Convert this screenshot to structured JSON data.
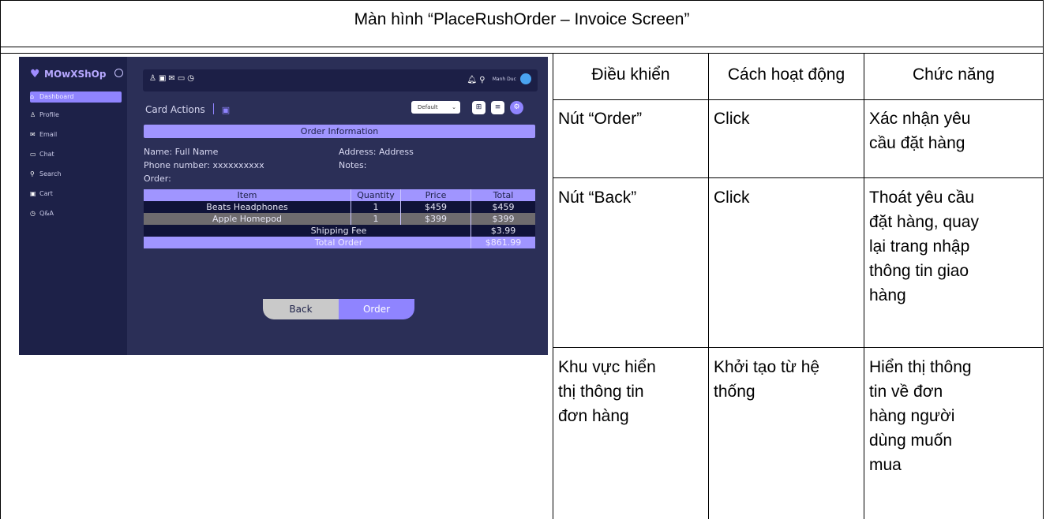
{
  "title": "Màn hình “PlaceRushOrder – Invoice Screen”",
  "table": {
    "headers": [
      "Điều khiển",
      "Cách hoạt động",
      "Chức năng"
    ],
    "rows": [
      {
        "control": "Nút “Order”",
        "action": "Click",
        "function_lines": [
          "Xác nhận yêu",
          "cầu đặt hàng"
        ]
      },
      {
        "control": "Nút “Back”",
        "action": "Click",
        "function_lines": [
          "Thoát yêu cầu",
          "đặt hàng, quay",
          "lại trang nhập",
          "thông tin giao",
          "hàng"
        ]
      },
      {
        "control_lines": [
          "Khu vực hiển",
          "thị thông tin",
          "đơn hàng"
        ],
        "action_lines": [
          "Khởi tạo từ hệ",
          "thống"
        ],
        "function_lines": [
          "Hiển thị thông",
          "tin về đơn",
          "hàng người",
          "dùng muốn",
          "mua"
        ]
      }
    ]
  },
  "screenshot": {
    "app": {
      "name": "MOwXShOp",
      "logo_icon": "heart-icon"
    },
    "sidebar": {
      "items": [
        {
          "label": "Dashboard",
          "icon": "home-icon",
          "active": true
        },
        {
          "label": "Profile",
          "icon": "user-icon",
          "active": false
        },
        {
          "label": "Email",
          "icon": "mail-icon",
          "active": false
        },
        {
          "label": "Chat",
          "icon": "chat-icon",
          "active": false
        },
        {
          "label": "Search",
          "icon": "search-icon",
          "active": false
        },
        {
          "label": "Cart",
          "icon": "cart-icon",
          "active": false
        },
        {
          "label": "Q&A",
          "icon": "help-icon",
          "active": false
        }
      ]
    },
    "topbar": {
      "user_name": "Manh Duc"
    },
    "card_actions": {
      "label": "Card Actions",
      "select_value": "Default"
    },
    "order": {
      "heading": "Order Information",
      "name": "Name: Full Name",
      "address": "Address: Address",
      "phone": "Phone number: xxxxxxxxxx",
      "notes": "Notes:",
      "order_label": "Order:",
      "columns": [
        "Item",
        "Quantity",
        "Price",
        "Total"
      ],
      "items": [
        {
          "item": "Beats Headphones",
          "quantity": "1",
          "price": "$459",
          "total": "$459"
        },
        {
          "item": "Apple Homepod",
          "quantity": "1",
          "price": "$399",
          "total": "$399"
        }
      ],
      "shipping_label": "Shipping Fee",
      "shipping_total": "$3.99",
      "total_label": "Total Order",
      "total_value": "$861.99"
    },
    "buttons": {
      "back": "Back",
      "order": "Order"
    },
    "colors": {
      "accent": "#8f84ff",
      "sidebar": "#1d2148",
      "panel": "#2b2f57"
    }
  }
}
